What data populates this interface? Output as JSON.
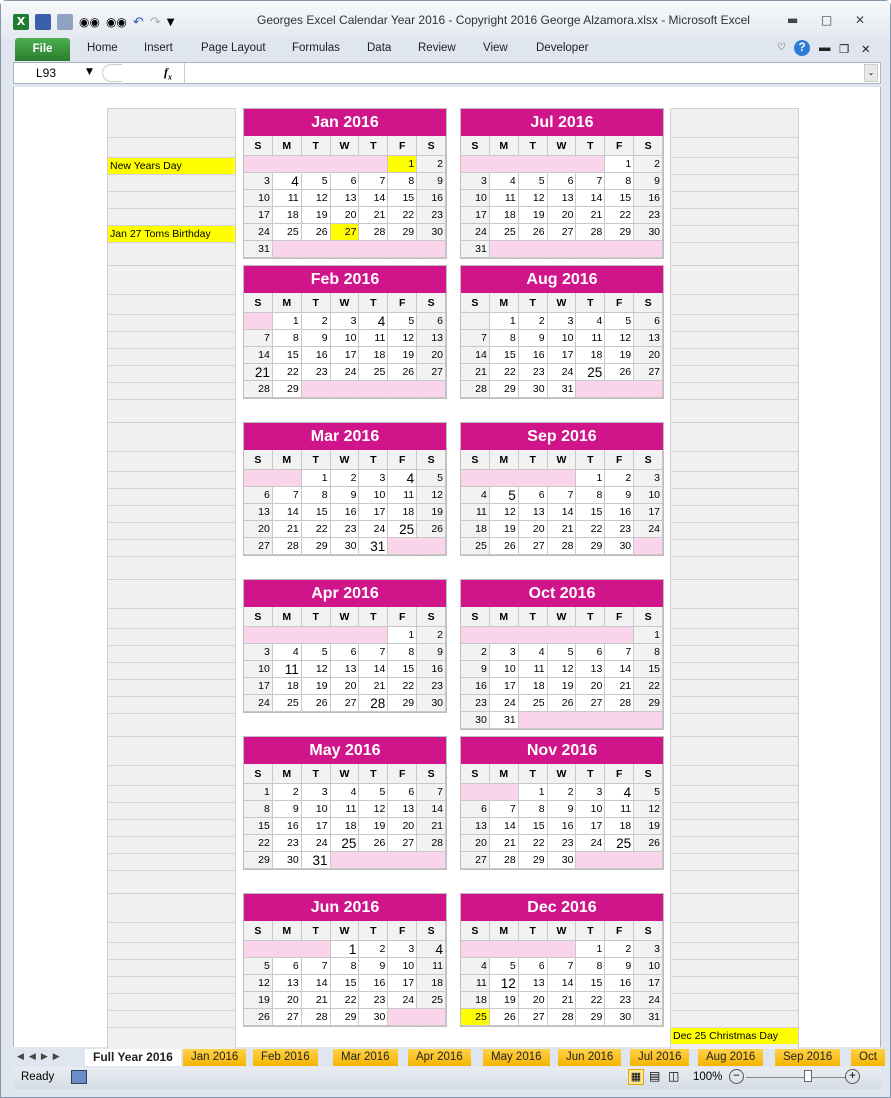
{
  "window": {
    "title": "Georges Excel Calendar Year 2016  -  Copyright 2016 George Alzamora.xlsx  -  Microsoft Excel"
  },
  "ribbon": {
    "tabs": [
      "File",
      "Home",
      "Insert",
      "Page Layout",
      "Formulas",
      "Data",
      "Review",
      "View",
      "Developer"
    ]
  },
  "formula_bar": {
    "name_box": "L93",
    "fx": "fx",
    "value": ""
  },
  "calendar": {
    "weekday_headers": [
      "S",
      "M",
      "T",
      "W",
      "T",
      "F",
      "S"
    ],
    "months": [
      {
        "title": "Jan 2016",
        "start": 5,
        "days": 31,
        "big": [
          4
        ],
        "yellow": [
          1,
          27
        ]
      },
      {
        "title": "Feb 2016",
        "start": 1,
        "days": 29,
        "big": [
          4,
          21
        ],
        "yellow": []
      },
      {
        "title": "Mar 2016",
        "start": 2,
        "days": 31,
        "big": [
          4,
          25,
          31
        ],
        "yellow": []
      },
      {
        "title": "Apr 2016",
        "start": 5,
        "days": 30,
        "big": [
          11,
          28
        ],
        "yellow": []
      },
      {
        "title": "May 2016",
        "start": 0,
        "days": 31,
        "big": [
          25,
          31
        ],
        "yellow": []
      },
      {
        "title": "Jun 2016",
        "start": 3,
        "days": 30,
        "big": [
          1,
          4
        ],
        "yellow": []
      },
      {
        "title": "Jul 2016",
        "start": 5,
        "days": 31,
        "big": [],
        "yellow": []
      },
      {
        "title": "Aug 2016",
        "start": 1,
        "days": 31,
        "big": [
          25
        ],
        "yellow": []
      },
      {
        "title": "Sep 2016",
        "start": 4,
        "days": 30,
        "big": [
          5
        ],
        "yellow": []
      },
      {
        "title": "Oct 2016",
        "start": 6,
        "days": 31,
        "big": [],
        "yellow": []
      },
      {
        "title": "Nov 2016",
        "start": 2,
        "days": 30,
        "big": [
          4,
          25
        ],
        "yellow": []
      },
      {
        "title": "Dec 2016",
        "start": 4,
        "days": 31,
        "big": [
          12
        ],
        "yellow": [
          25
        ]
      }
    ],
    "notes": [
      {
        "block": 0,
        "side": "left",
        "row": 2,
        "text": "New Years Day"
      },
      {
        "block": 0,
        "side": "left",
        "row": 6,
        "text": "Jan 27 Toms Birthday"
      },
      {
        "block": 5,
        "side": "right",
        "row": 7,
        "text": "Dec 25 Christmas Day"
      }
    ]
  },
  "sheet_tabs": [
    "Full Year 2016",
    "Jan 2016",
    "Feb 2016",
    "Mar 2016",
    "Apr 2016",
    "May 2016",
    "Jun 2016",
    "Jul 2016",
    "Aug 2016",
    "Sep 2016",
    "Oct"
  ],
  "status": {
    "ready": "Ready",
    "zoom": "100%",
    "zoom_level": 100
  }
}
